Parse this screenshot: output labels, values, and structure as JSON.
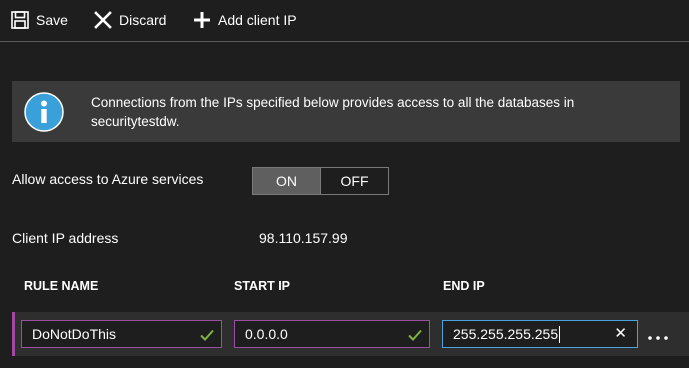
{
  "toolbar": {
    "save_label": "Save",
    "discard_label": "Discard",
    "add_client_ip_label": "Add client IP"
  },
  "info": {
    "message": "Connections from the IPs specified below provides access to all the databases in securitytestdw."
  },
  "azure_access": {
    "label": "Allow access to Azure services",
    "on_label": "ON",
    "off_label": "OFF",
    "selected": "ON"
  },
  "client_ip": {
    "label": "Client IP address",
    "value": "98.110.157.99"
  },
  "table": {
    "headers": [
      "RULE NAME",
      "START IP",
      "END IP"
    ],
    "rows": [
      {
        "rule_name": "DoNotDoThis",
        "start_ip": "0.0.0.0",
        "end_ip": "255.255.255.255"
      }
    ]
  },
  "colors": {
    "background": "#1e1e1e",
    "banner": "#3a3a3a",
    "info_icon": "#3aa0da",
    "check": "#7cb342",
    "rule_accent": "#a349a4",
    "focus_border": "#4aa3df"
  },
  "icons": {
    "save": "save-icon",
    "discard": "close-icon",
    "add": "plus-icon",
    "info": "info-icon",
    "valid": "checkmark-icon",
    "clear": "clear-icon",
    "more": "ellipsis-icon"
  }
}
